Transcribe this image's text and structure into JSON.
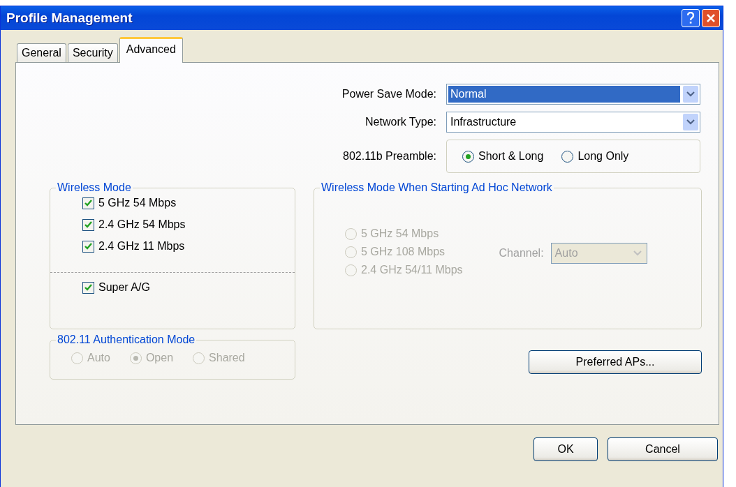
{
  "window": {
    "title": "Profile Management"
  },
  "tabs": [
    {
      "label": "General",
      "selected": false
    },
    {
      "label": "Security",
      "selected": false
    },
    {
      "label": "Advanced",
      "selected": true
    }
  ],
  "power_save_mode": {
    "label": "Power Save Mode:",
    "value": "Normal",
    "focused": true
  },
  "network_type": {
    "label": "Network Type:",
    "value": "Infrastructure",
    "focused": false
  },
  "preamble": {
    "label": "802.11b Preamble:",
    "options": [
      {
        "label": "Short & Long",
        "selected": true
      },
      {
        "label": "Long Only",
        "selected": false
      }
    ]
  },
  "wireless_mode": {
    "title": "Wireless Mode",
    "options": [
      {
        "label": "5 GHz 54 Mbps",
        "checked": true
      },
      {
        "label": "2.4 GHz 54 Mbps",
        "checked": true
      },
      {
        "label": "2.4 GHz 11 Mbps",
        "checked": true
      }
    ],
    "super_ag": {
      "label": "Super A/G",
      "checked": true
    }
  },
  "auth_mode": {
    "title": "802.11 Authentication Mode",
    "disabled": true,
    "options": [
      {
        "label": "Auto",
        "selected": false
      },
      {
        "label": "Open",
        "selected": true
      },
      {
        "label": "Shared",
        "selected": false
      }
    ]
  },
  "adhoc": {
    "title": "Wireless Mode When Starting Ad Hoc Network",
    "disabled": true,
    "options": [
      {
        "label": "5 GHz 54 Mbps",
        "selected": false
      },
      {
        "label": "5 GHz 108 Mbps",
        "selected": false
      },
      {
        "label": "2.4 GHz 54/11 Mbps",
        "selected": false
      }
    ],
    "channel": {
      "label": "Channel:",
      "value": "Auto"
    }
  },
  "preferred_button": "Preferred APs...",
  "buttons": [
    "OK",
    "Cancel"
  ]
}
